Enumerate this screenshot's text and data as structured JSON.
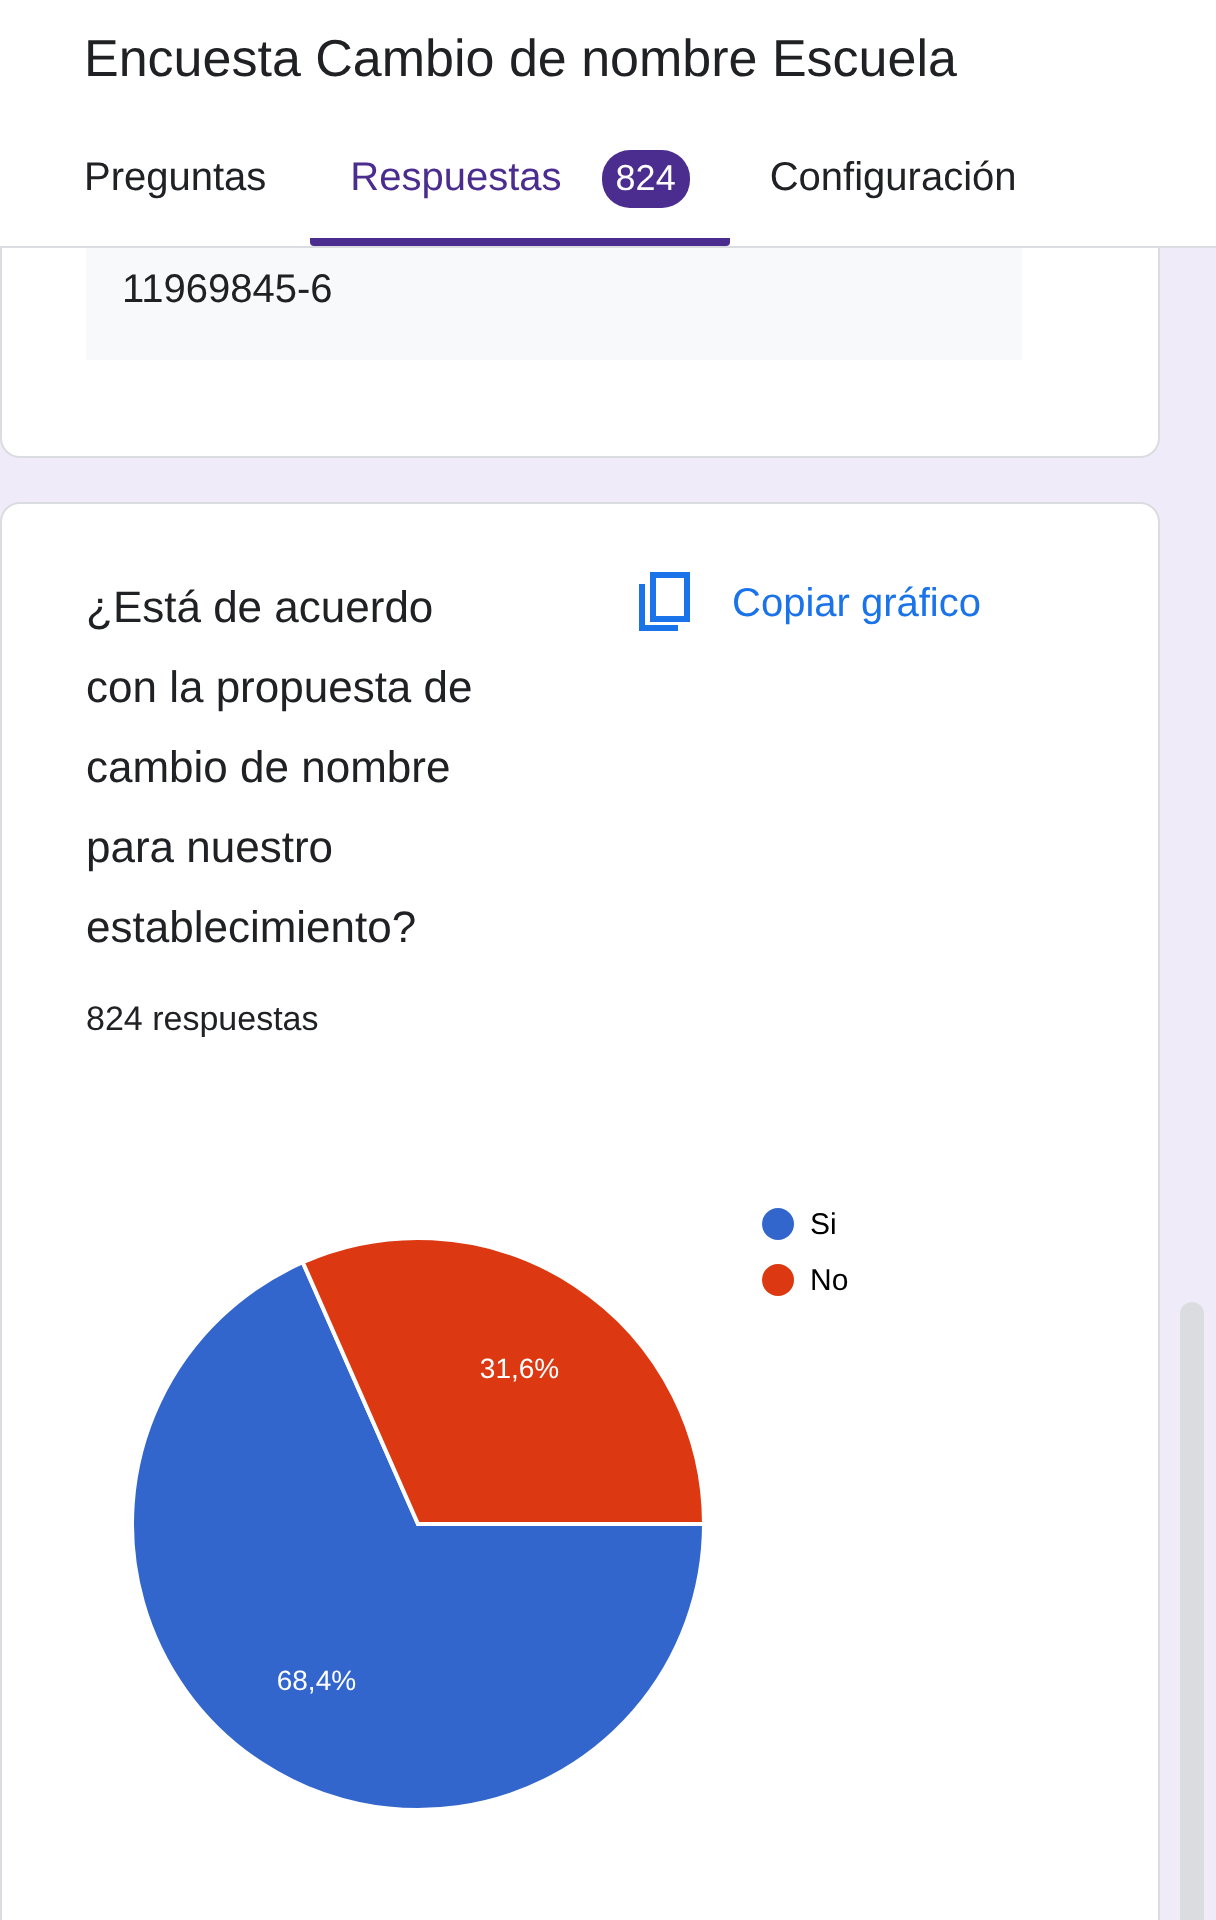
{
  "header": {
    "title": "Encuesta Cambio de nombre Escuela"
  },
  "tabs": [
    {
      "label": "Preguntas",
      "selected": false
    },
    {
      "label": "Respuestas",
      "selected": true,
      "badge": "824"
    },
    {
      "label": "Configuración",
      "selected": false
    }
  ],
  "previous_card": {
    "answer": "11969845-6"
  },
  "question_card": {
    "question": "¿Está de acuerdo con la propuesta de cambio de nombre para nuestro establecimiento?",
    "copy_label": "Copiar gráfico",
    "count": "824 respuestas",
    "chart_data": {
      "type": "pie",
      "categories": [
        "Si",
        "No"
      ],
      "series": [
        {
          "values": [
            68.4,
            31.6
          ]
        }
      ],
      "legend": "right",
      "colors": [
        "#3366cc",
        "#dc3912"
      ],
      "value_labels": [
        "68,4%",
        "31,6%"
      ]
    }
  }
}
